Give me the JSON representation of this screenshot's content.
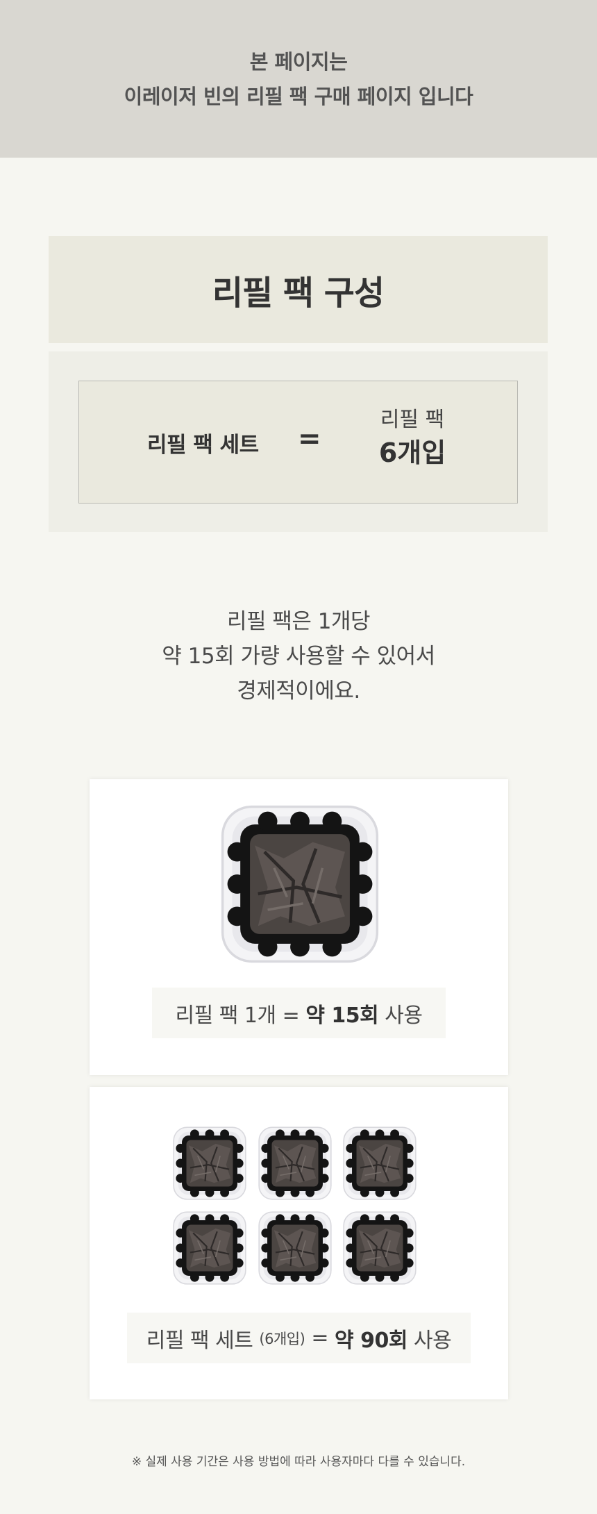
{
  "banner": {
    "line1": "본 페이지는",
    "line2": "이레이저 빈의 리필 팩 구매 페이지 입니다"
  },
  "section": {
    "title": "리필 팩 구성"
  },
  "composition": {
    "left": "리필 팩 세트",
    "equals": "=",
    "right_label": "리필 팩",
    "right_count": "6개입"
  },
  "description": {
    "line1": "리필 팩은 1개당",
    "line2": "약 15회 가량 사용할 수 있어서",
    "line3": "경제적이에요."
  },
  "single_card": {
    "caption_prefix": "리필 팩 1개  =",
    "caption_bold": "약 15회",
    "caption_suffix": "사용"
  },
  "set_card": {
    "caption_prefix": "리필 팩 세트",
    "caption_small": "(6개입)",
    "caption_equals": "=",
    "caption_bold": "약 90회",
    "caption_suffix": "사용"
  },
  "footnote": "※ 실제 사용 기간은 사용 방법에 따라 사용자마다 다를 수 있습니다."
}
